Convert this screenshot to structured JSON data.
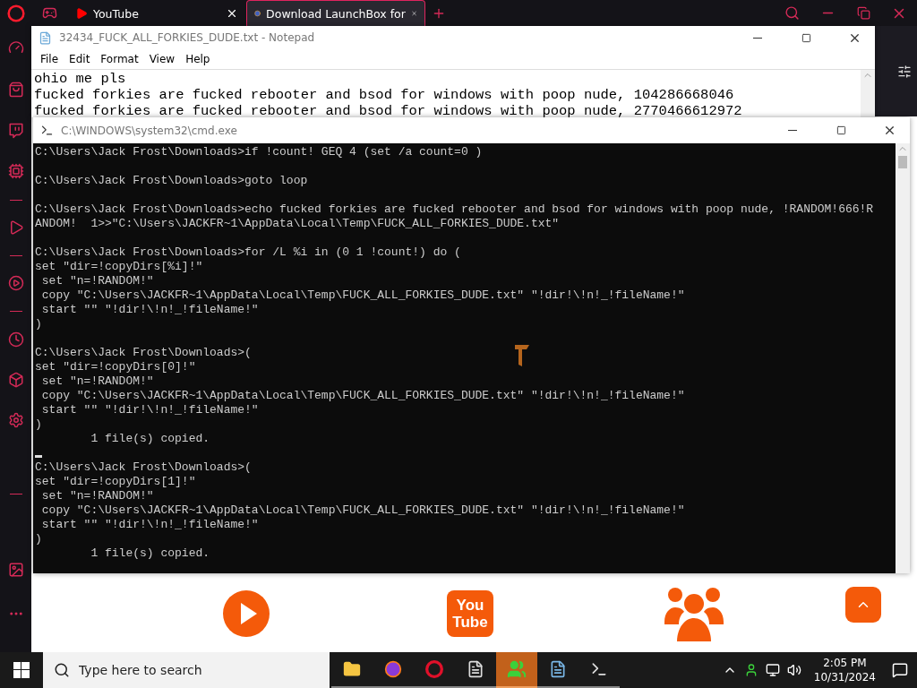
{
  "browser": {
    "tabs": [
      {
        "label": "YouTube",
        "selected": false
      },
      {
        "label": "Download LaunchBox for",
        "selected": true
      }
    ]
  },
  "notepad": {
    "title": "32434_FUCK_ALL_FORKIES_DUDE.txt - Notepad",
    "menu": [
      "File",
      "Edit",
      "Format",
      "View",
      "Help"
    ],
    "lines": [
      "ohio me pls",
      "fucked forkies are fucked rebooter and bsod for windows with poop nude, 104286668046",
      "fucked forkies are fucked rebooter and bsod for windows with poop nude, 2770466612972"
    ]
  },
  "cmd": {
    "title": "C:\\WINDOWS\\system32\\cmd.exe",
    "blocks": [
      [
        "C:\\Users\\Jack Frost\\Downloads>if !count! GEQ 4 (set /a count=0 )"
      ],
      [
        "C:\\Users\\Jack Frost\\Downloads>goto loop"
      ],
      [
        "C:\\Users\\Jack Frost\\Downloads>echo fucked forkies are fucked rebooter and bsod for windows with poop nude, !RANDOM!666!R",
        "ANDOM!  1>>\"C:\\Users\\JACKFR~1\\AppData\\Local\\Temp\\FUCK_ALL_FORKIES_DUDE.txt\""
      ],
      [
        "C:\\Users\\Jack Frost\\Downloads>for /L %i in (0 1 !count!) do (",
        "set \"dir=!copyDirs[%i]!\"",
        " set \"n=!RANDOM!\"",
        " copy \"C:\\Users\\JACKFR~1\\AppData\\Local\\Temp\\FUCK_ALL_FORKIES_DUDE.txt\" \"!dir!\\!n!_!fileName!\"",
        " start \"\" \"!dir!\\!n!_!fileName!\"",
        ")"
      ],
      [
        "C:\\Users\\Jack Frost\\Downloads>(",
        "set \"dir=!copyDirs[0]!\"",
        " set \"n=!RANDOM!\"",
        " copy \"C:\\Users\\JACKFR~1\\AppData\\Local\\Temp\\FUCK_ALL_FORKIES_DUDE.txt\" \"!dir!\\!n!_!fileName!\"",
        " start \"\" \"!dir!\\!n!_!fileName!\"",
        ")",
        "        1 file(s) copied."
      ],
      [
        "C:\\Users\\Jack Frost\\Downloads>(",
        "set \"dir=!copyDirs[1]!\"",
        " set \"n=!RANDOM!\"",
        " copy \"C:\\Users\\JACKFR~1\\AppData\\Local\\Temp\\FUCK_ALL_FORKIES_DUDE.txt\" \"!dir!\\!n!_!fileName!\"",
        " start \"\" \"!dir!\\!n!_!fileName!\"",
        ")",
        "        1 file(s) copied."
      ]
    ]
  },
  "youtube_logo": [
    "You",
    "Tube"
  ],
  "taskbar": {
    "search": {
      "placeholder": "Type here to search"
    },
    "apps": [
      {
        "selected": false
      },
      {
        "selected": false
      },
      {
        "selected": false
      },
      {
        "selected": false
      },
      {
        "selected": true
      },
      {
        "selected": false
      },
      {
        "selected": false
      }
    ],
    "time": "2:05 PM",
    "date": "10/31/2024"
  }
}
